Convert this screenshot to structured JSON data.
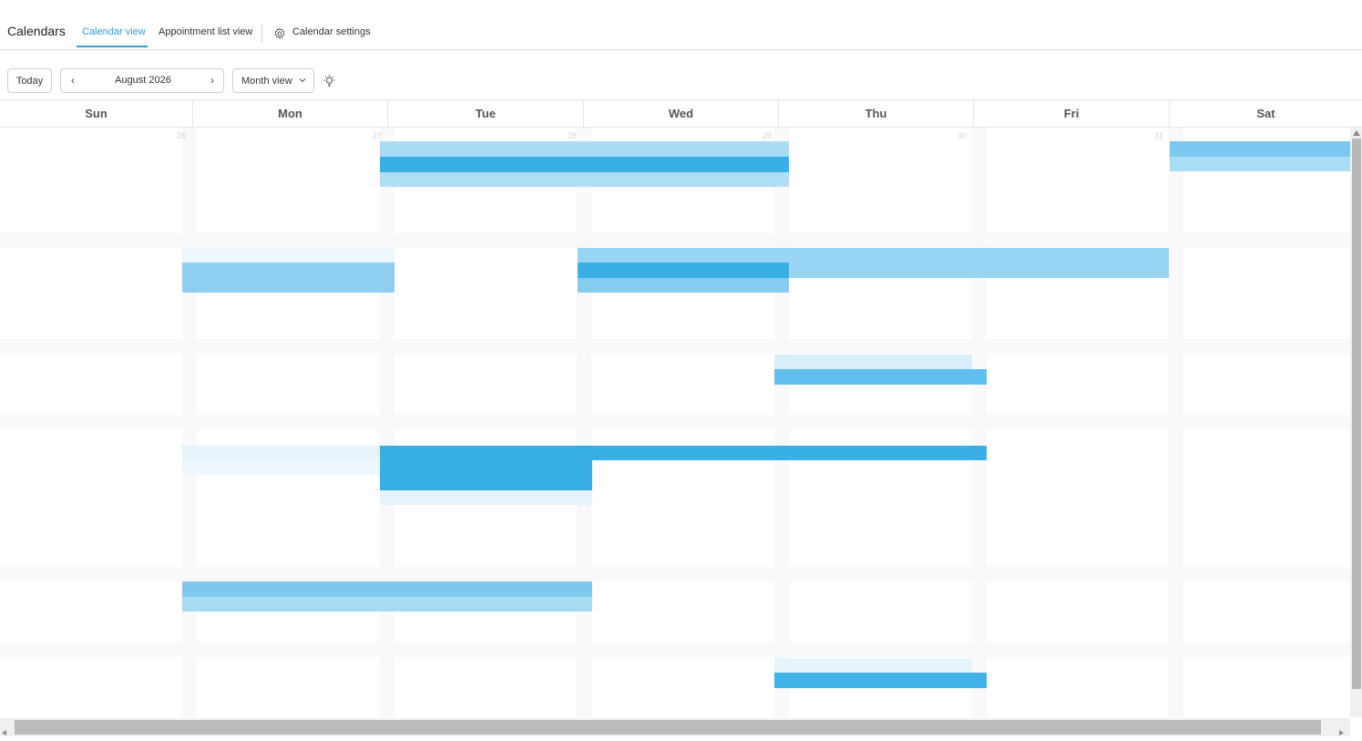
{
  "header": {
    "title": "Calendars",
    "tabs": [
      {
        "label": "Calendar view",
        "active": true
      },
      {
        "label": "Appointment list view",
        "active": false
      },
      {
        "label": "Calendar settings",
        "active": false,
        "icon": "gear-icon"
      }
    ]
  },
  "toolbar": {
    "today_label": "Today",
    "month_label": "August 2026",
    "prev_icon": "chevron-left-icon",
    "next_icon": "chevron-right-icon",
    "view_label": "Month view",
    "view_icon": "chevron-down-icon",
    "extra_icon": "lightbulb-icon"
  },
  "calendar": {
    "days": [
      "Sun",
      "Mon",
      "Tue",
      "Wed",
      "Thu",
      "Fri",
      "Sat"
    ],
    "first_week_dates": [
      "26",
      "27",
      "28",
      "29",
      "30",
      "31"
    ]
  },
  "colors": {
    "accent": "#2b9fd9",
    "event_dark": "#3aafe6",
    "event_mid": "#79c8f0",
    "event_light": "#a9dcf5"
  }
}
